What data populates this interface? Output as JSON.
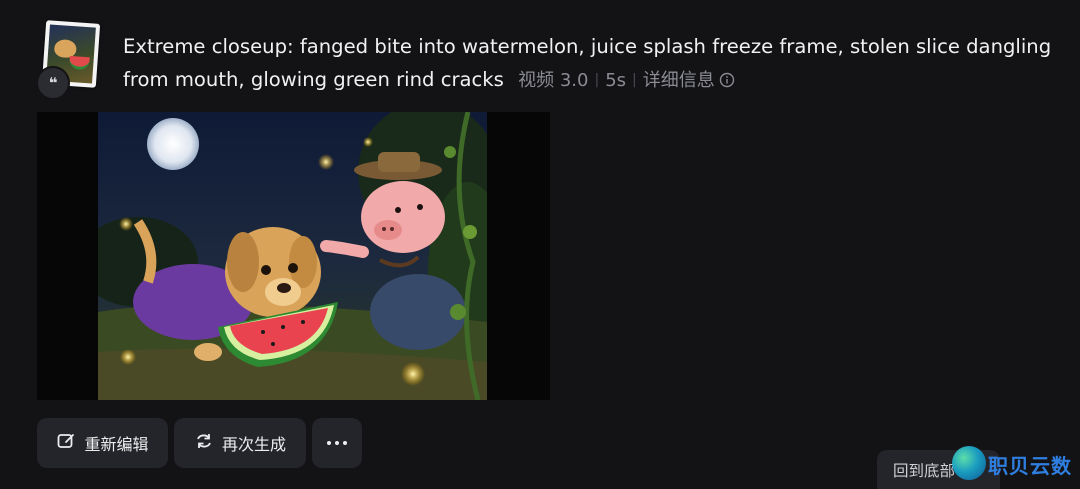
{
  "prompt": {
    "text": "Extreme closeup: fanged bite into watermelon, juice splash freeze frame, stolen slice dangling from mouth, glowing green rind cracks",
    "model": "视频 3.0",
    "duration": "5s",
    "details_label": "详细信息"
  },
  "thumbnail": {
    "badge_glyph": "❝",
    "icon": "quote-icon"
  },
  "actions": {
    "edit_label": "重新编辑",
    "regenerate_label": "再次生成",
    "more_icon": "more-dots-icon"
  },
  "back_to_bottom_label": "回到底部",
  "watermark": {
    "text": "职贝云数"
  },
  "colors": {
    "background": "#131316",
    "button_bg": "#24252a",
    "meta_text": "#8a8b93",
    "watermark_blue": "#2f7fe0"
  }
}
